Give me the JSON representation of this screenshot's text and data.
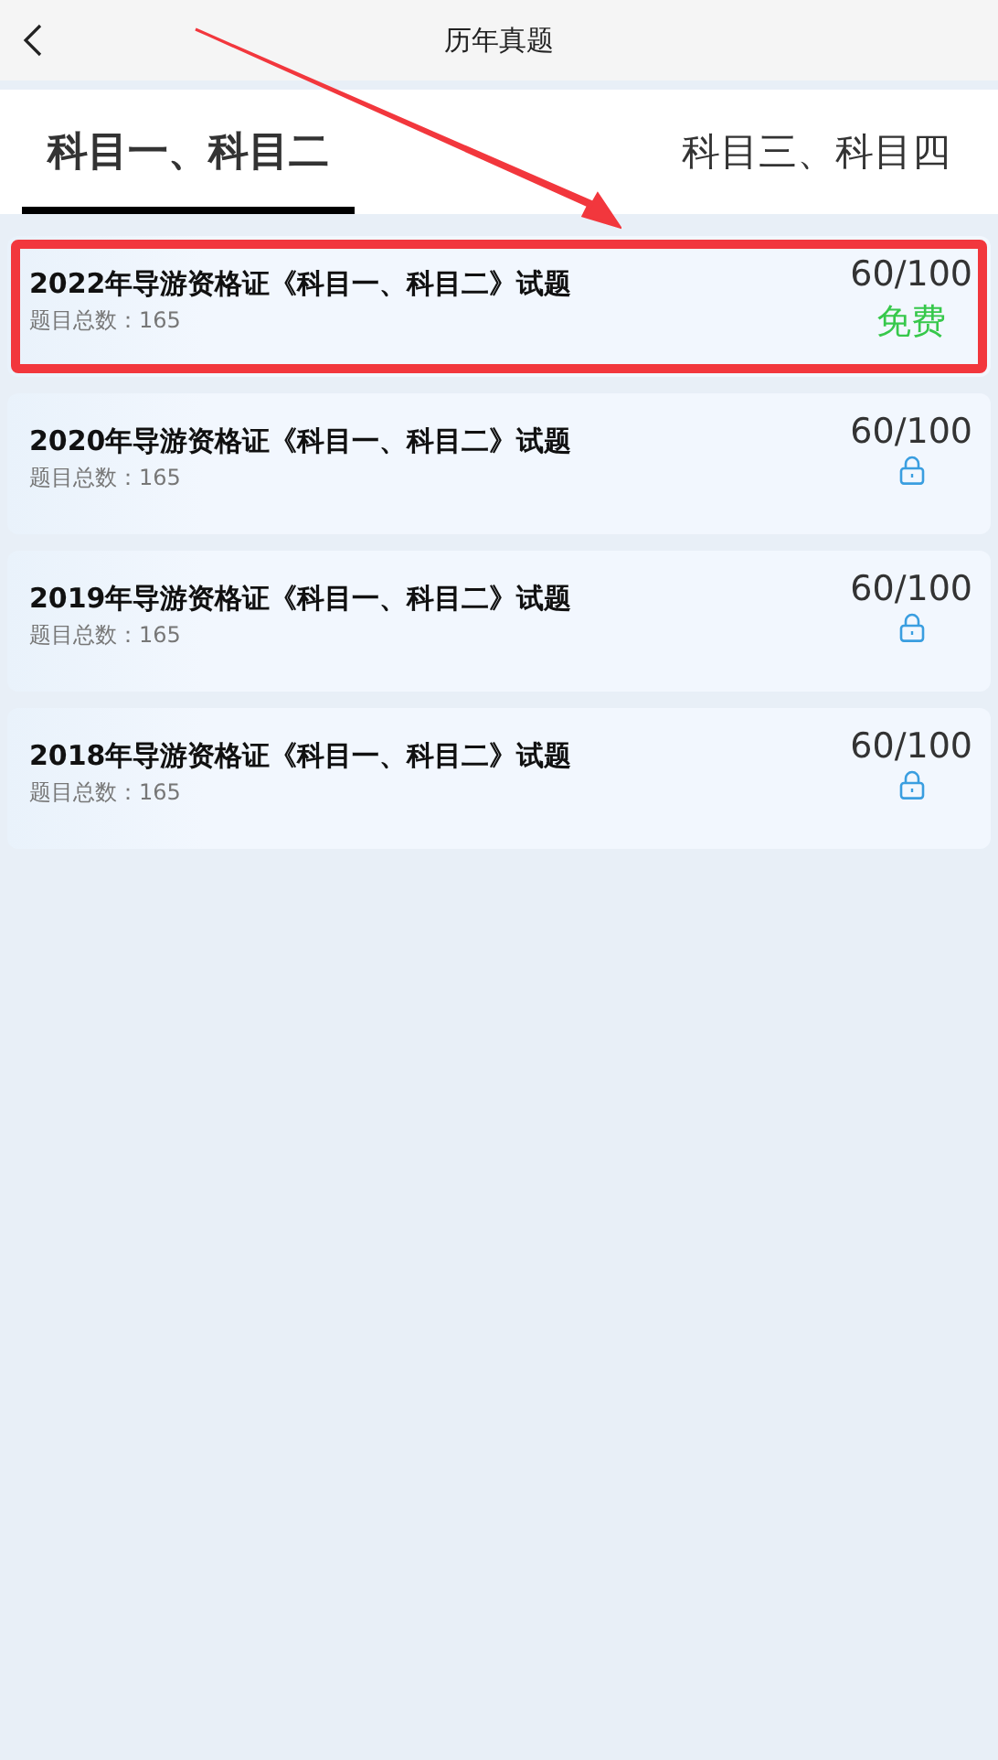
{
  "header": {
    "title": "历年真题"
  },
  "tabs": [
    {
      "label": "科目一、科目二",
      "selected": true
    },
    {
      "label": "科目三、科目四",
      "selected": false
    }
  ],
  "papers": [
    {
      "title": "2022年导游资格证《科目一、科目二》试题",
      "count": "题目总数：165",
      "score": "60/100",
      "kind": "free",
      "badge": "免费",
      "highlighted": true
    },
    {
      "title": "2020年导游资格证《科目一、科目二》试题",
      "count": "题目总数：165",
      "score": "60/100",
      "kind": "locked",
      "highlighted": false
    },
    {
      "title": "2019年导游资格证《科目一、科目二》试题",
      "count": "题目总数：165",
      "score": "60/100",
      "kind": "locked",
      "highlighted": false
    },
    {
      "title": "2018年导游资格证《科目一、科目二》试题",
      "count": "题目总数：165",
      "score": "60/100",
      "kind": "locked",
      "highlighted": false
    }
  ],
  "annotation": {
    "arrow": true
  }
}
